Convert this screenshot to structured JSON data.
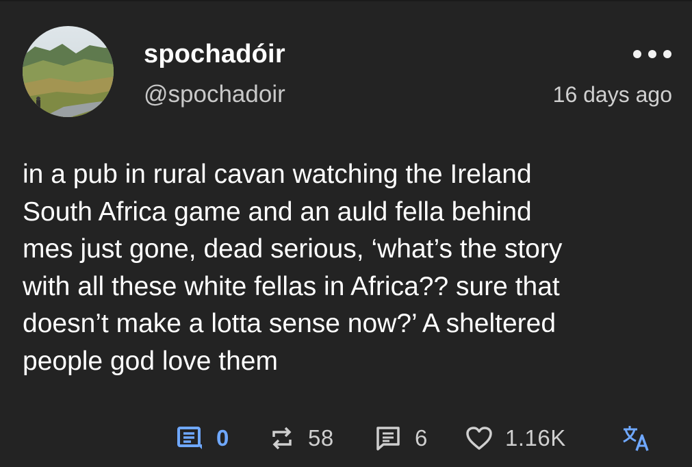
{
  "post": {
    "display_name": "spochadóir",
    "handle": "@spochadoir",
    "timestamp": "16 days ago",
    "body_lines": [
      "in a pub in rural cavan watching the Ireland",
      "South Africa game and an auld fella behind",
      "mes just gone, dead serious, ‘what’s the story",
      "with all these white fellas in Africa?? sure that",
      "doesn’t make a lotta sense now?’ A sheltered",
      "people god love them"
    ]
  },
  "actions": {
    "comments": {
      "icon": "comment-icon",
      "count": "0"
    },
    "reposts": {
      "icon": "repost-icon",
      "count": "58"
    },
    "quotes": {
      "icon": "quote-icon",
      "count": "6"
    },
    "likes": {
      "icon": "heart-icon",
      "count": "1.16K"
    },
    "translate": {
      "icon": "translate-icon"
    }
  },
  "colors": {
    "background": "#232323",
    "accent": "#6fa8ff",
    "muted": "#cfcfcf"
  }
}
